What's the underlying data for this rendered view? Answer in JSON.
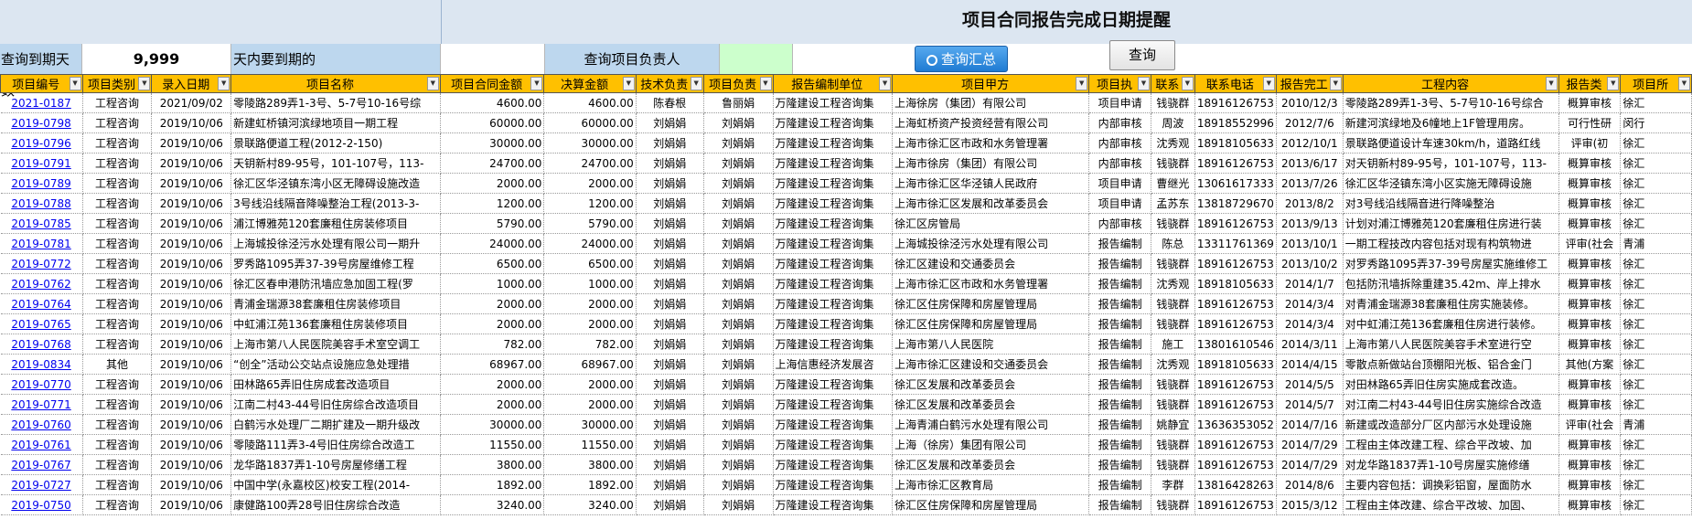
{
  "header": {
    "title": "项目合同报告完成日期提醒"
  },
  "query": {
    "days_label": "查询到期天数",
    "days_value": "9,999",
    "days_suffix": "天内要到期的",
    "person_label": "查询项目负责人",
    "person_value": "",
    "summary_button": "查询汇总",
    "query_button": "查询"
  },
  "columns": [
    "项目编号",
    "项目类别",
    "录入日期",
    "项目名称",
    "项目合同金额",
    "决算金额",
    "技术负责",
    "项目负责",
    "报告编制单位",
    "项目甲方",
    "项目执",
    "联系",
    "联系电话",
    "报告完工",
    "工程内容",
    "报告类",
    "项目所"
  ],
  "rows": [
    [
      "2021-0187",
      "工程咨询",
      "2021/09/02",
      "零陵路289弄1-3号、5-7号10-16号综",
      "4600.00",
      "4600.00",
      "陈春根",
      "鲁丽娟",
      "万隆建设工程咨询集",
      "上海徐房（集团）有限公司",
      "项目申请",
      "钱骁群",
      "18916126753",
      "2010/12/3",
      "零陵路289弄1-3号、5-7号10-16号综合",
      "概算审核",
      "徐汇"
    ],
    [
      "2019-0798",
      "工程咨询",
      "2019/10/06",
      "新建虹桥镇河滨绿地项目一期工程",
      "60000.00",
      "60000.00",
      "刘娟娟",
      "刘娟娟",
      "万隆建设工程咨询集",
      "上海虹桥资产投资经营有限公司",
      "内部审核",
      "周波",
      "18918552996",
      "2012/7/6",
      "新建河滨绿地及6幢地上1F管理用房。",
      "可行性研",
      "闵行"
    ],
    [
      "2019-0796",
      "工程咨询",
      "2019/10/06",
      "景联路便道工程(2012-2-150)",
      "30000.00",
      "30000.00",
      "刘娟娟",
      "刘娟娟",
      "万隆建设工程咨询集",
      "上海市徐汇区市政和水务管理署",
      "内部审核",
      "沈秀观",
      "18918105633",
      "2012/10/1",
      "景联路便道设计车速30km/h，道路红线",
      "评审(初",
      "徐汇"
    ],
    [
      "2019-0791",
      "工程咨询",
      "2019/10/06",
      "天钥新村89-95号，101-107号，113-",
      "24700.00",
      "24700.00",
      "刘娟娟",
      "刘娟娟",
      "万隆建设工程咨询集",
      "上海市徐房（集团）有限公司",
      "内部审核",
      "钱骁群",
      "18916126753",
      "2013/6/17",
      "对天钥新村89-95号，101-107号，113-",
      "概算审核",
      "徐汇"
    ],
    [
      "2019-0789",
      "工程咨询",
      "2019/10/06",
      "徐汇区华泾镇东湾小区无障碍设施改造",
      "2000.00",
      "2000.00",
      "刘娟娟",
      "刘娟娟",
      "万隆建设工程咨询集",
      "上海市徐汇区华泾镇人民政府",
      "项目申请",
      "曹继光",
      "13061617333",
      "2013/7/26",
      "徐汇区华泾镇东湾小区实施无障碍设施",
      "概算审核",
      "徐汇"
    ],
    [
      "2019-0788",
      "工程咨询",
      "2019/10/06",
      "3号线沿线隔音降噪整治工程(2013-3-",
      "1200.00",
      "1200.00",
      "刘娟娟",
      "刘娟娟",
      "万隆建设工程咨询集",
      "上海市徐汇区发展和改革委员会",
      "项目申请",
      "孟苏东",
      "13818729670",
      "2013/8/2",
      "对3号线沿线隔音进行降噪整治",
      "概算审核",
      "徐汇"
    ],
    [
      "2019-0785",
      "工程咨询",
      "2019/10/06",
      "浦江博雅苑120套廉租住房装修项目",
      "5790.00",
      "5790.00",
      "刘娟娟",
      "刘娟娟",
      "万隆建设工程咨询集",
      "徐汇区房管局",
      "内部审核",
      "钱骁群",
      "18916126753",
      "2013/9/13",
      "计划对浦江博雅苑120套廉租住房进行装",
      "概算审核",
      "徐汇"
    ],
    [
      "2019-0781",
      "工程咨询",
      "2019/10/06",
      "上海城投徐泾污水处理有限公司一期升",
      "24000.00",
      "24000.00",
      "刘娟娟",
      "刘娟娟",
      "万隆建设工程咨询集",
      "上海城投徐泾污水处理有限公司",
      "报告编制",
      "陈总",
      "13311761369",
      "2013/10/1",
      "一期工程技改内容包括对现有构筑物进",
      "评审(社会",
      "青浦"
    ],
    [
      "2019-0772",
      "工程咨询",
      "2019/10/06",
      "罗秀路1095弄37-39号房屋维修工程",
      "6500.00",
      "6500.00",
      "刘娟娟",
      "刘娟娟",
      "万隆建设工程咨询集",
      "徐汇区建设和交通委员会",
      "报告编制",
      "钱骁群",
      "18916126753",
      "2013/10/2",
      "对罗秀路1095弄37-39号房屋实施维修工",
      "概算审核",
      "徐汇"
    ],
    [
      "2019-0762",
      "工程咨询",
      "2019/10/06",
      "徐汇区春申港防汛墙应急加固工程(罗",
      "1000.00",
      "1000.00",
      "刘娟娟",
      "刘娟娟",
      "万隆建设工程咨询集",
      "上海市徐汇区市政和水务管理署",
      "报告编制",
      "沈秀观",
      "18918105633",
      "2014/1/7",
      "包括防汛墙拆除重建35.42m、岸上排水",
      "概算审核",
      "徐汇"
    ],
    [
      "2019-0764",
      "工程咨询",
      "2019/10/06",
      "青浦金瑞源38套廉租住房装修项目",
      "2000.00",
      "2000.00",
      "刘娟娟",
      "刘娟娟",
      "万隆建设工程咨询集",
      "徐汇区住房保障和房屋管理局",
      "报告编制",
      "钱骁群",
      "18916126753",
      "2014/3/4",
      "对青浦金瑞源38套廉租住房实施装修。",
      "概算审核",
      "徐汇"
    ],
    [
      "2019-0765",
      "工程咨询",
      "2019/10/06",
      "中虹浦江苑136套廉租住房装修项目",
      "2000.00",
      "2000.00",
      "刘娟娟",
      "刘娟娟",
      "万隆建设工程咨询集",
      "徐汇区住房保障和房屋管理局",
      "报告编制",
      "钱骁群",
      "18916126753",
      "2014/3/4",
      "对中虹浦江苑136套廉租住房进行装修。",
      "概算审核",
      "徐汇"
    ],
    [
      "2019-0768",
      "工程咨询",
      "2019/10/06",
      "上海市第八人民医院美容手术室空调工",
      "782.00",
      "782.00",
      "刘娟娟",
      "刘娟娟",
      "万隆建设工程咨询集",
      "上海市第八人民医院",
      "报告编制",
      "施工",
      "13801610546",
      "2014/3/11",
      "上海市第八人民医院美容手术室进行空",
      "概算审核",
      "徐汇"
    ],
    [
      "2019-0834",
      "其他",
      "2019/10/06",
      "“创全”活动公交站点设施应急处理措",
      "68967.00",
      "68967.00",
      "刘娟娟",
      "刘娟娟",
      "上海信惠经济发展咨",
      "上海市徐汇区建设和交通委员会",
      "报告编制",
      "沈秀观",
      "18918105633",
      "2014/4/15",
      "零散点新做站台顶棚阳光板、铝合金门",
      "其他(方案",
      "徐汇"
    ],
    [
      "2019-0770",
      "工程咨询",
      "2019/10/06",
      "田林路65弄旧住房成套改造项目",
      "2000.00",
      "2000.00",
      "刘娟娟",
      "刘娟娟",
      "万隆建设工程咨询集",
      "徐汇区发展和改革委员会",
      "报告编制",
      "钱骁群",
      "18916126753",
      "2014/5/5",
      "对田林路65弄旧住房实施成套改造。",
      "概算审核",
      "徐汇"
    ],
    [
      "2019-0771",
      "工程咨询",
      "2019/10/06",
      "江南二村43-44号旧住房综合改造项目",
      "2000.00",
      "2000.00",
      "刘娟娟",
      "刘娟娟",
      "万隆建设工程咨询集",
      "徐汇区发展和改革委员会",
      "报告编制",
      "钱骁群",
      "18916126753",
      "2014/5/7",
      "对江南二村43-44号旧住房实施综合改造",
      "概算审核",
      "徐汇"
    ],
    [
      "2019-0760",
      "工程咨询",
      "2019/10/06",
      "白鹤污水处理厂二期扩建及一期升级改",
      "30000.00",
      "30000.00",
      "刘娟娟",
      "刘娟娟",
      "万隆建设工程咨询集",
      "上海青浦白鹤污水处理有限公司",
      "报告编制",
      "姚静宜",
      "13636353052",
      "2014/7/16",
      "新建或改造部分厂区内部污水处理设施",
      "评审(社会",
      "青浦"
    ],
    [
      "2019-0761",
      "工程咨询",
      "2019/10/06",
      "零陵路111弄3-4号旧住房综合改造工",
      "11550.00",
      "11550.00",
      "刘娟娟",
      "刘娟娟",
      "万隆建设工程咨询集",
      "上海（徐房）集团有限公司",
      "报告编制",
      "钱骁群",
      "18916126753",
      "2014/7/29",
      "工程由主体改建工程、综合平改坡、加",
      "概算审核",
      "徐汇"
    ],
    [
      "2019-0767",
      "工程咨询",
      "2019/10/06",
      "龙华路1837弄1-10号房屋修缮工程",
      "3800.00",
      "3800.00",
      "刘娟娟",
      "刘娟娟",
      "万隆建设工程咨询集",
      "徐汇区发展和改革委员会",
      "报告编制",
      "钱骁群",
      "18916126753",
      "2014/7/29",
      "对龙华路1837弄1-10号房屋实施修缮",
      "概算审核",
      "徐汇"
    ],
    [
      "2019-0727",
      "工程咨询",
      "2019/10/06",
      "中国中学(永嘉校区)校安工程(2014-",
      "1892.00",
      "1892.00",
      "刘娟娟",
      "刘娟娟",
      "万隆建设工程咨询集",
      "上海市徐汇区教育局",
      "报告编制",
      "李群",
      "13816428263",
      "2014/8/6",
      "主要内容包括：调换彩铝窗，屋面防水",
      "概算审核",
      "徐汇"
    ],
    [
      "2019-0750",
      "工程咨询",
      "2019/10/06",
      "康健路100弄28号旧住房综合改造",
      "3240.00",
      "3240.00",
      "刘娟娟",
      "刘娟娟",
      "万隆建设工程咨询集",
      "徐汇区住房保障和房屋管理局",
      "报告编制",
      "钱骁群",
      "18916126753",
      "2015/3/12",
      "工程由主体改建、综合平改坡、加固、",
      "概算审核",
      "徐汇"
    ]
  ]
}
